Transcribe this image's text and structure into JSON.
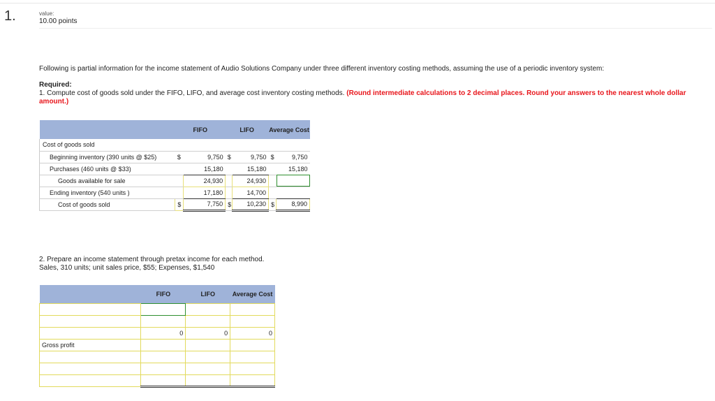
{
  "question": {
    "number": "1.",
    "value_label": "value:",
    "value_points": "10.00 points"
  },
  "intro": "Following is partial information for the income statement of Audio Solutions Company under three different inventory costing methods, assuming the use of a periodic inventory system:",
  "required": {
    "heading": "Required:",
    "part1_prefix": "1. Compute cost of goods sold under the FIFO, LIFO, and average cost inventory costing methods.",
    "part1_instruction": "(Round intermediate calculations to 2 decimal places. Round your answers to the nearest whole dollar amount.)",
    "part2_line1": "2. Prepare an income statement through pretax income for each method.",
    "part2_line2": "Sales, 310 units; unit sales price, $55; Expenses, $1,540"
  },
  "table1": {
    "headers": {
      "fifo": "FIFO",
      "lifo": "LIFO",
      "avg": "Average Cost"
    },
    "section_label": "Cost of goods sold",
    "rows": [
      {
        "label": "Beginning inventory (390 units @ $25)",
        "d1": "$",
        "fifo": "9,750",
        "d2": "$",
        "lifo": "9,750",
        "d3": "$",
        "avg": "9,750"
      },
      {
        "label": "Purchases (460 units @ $33)",
        "d1": "",
        "fifo": "15,180",
        "d2": "",
        "lifo": "15,180",
        "d3": "",
        "avg": "15,180"
      },
      {
        "label": "Goods available for sale",
        "d1": "",
        "fifo": "24,930",
        "d2": "",
        "lifo": "24,930",
        "d3": "",
        "avg": ""
      },
      {
        "label": "Ending inventory (540 units )",
        "d1": "",
        "fifo": "17,180",
        "d2": "",
        "lifo": "14,700",
        "d3": "",
        "avg": ""
      },
      {
        "label": "Cost of goods sold",
        "d1": "$",
        "fifo": "7,750",
        "d2": "$",
        "lifo": "10,230",
        "d3": "$",
        "avg": "8,990"
      }
    ]
  },
  "table2": {
    "headers": {
      "fifo": "FIFO",
      "lifo": "LIFO",
      "avg": "Average Cost"
    },
    "rows": [
      {
        "label": "",
        "fifo": "",
        "lifo": "",
        "avg": ""
      },
      {
        "label": "",
        "fifo": "",
        "lifo": "",
        "avg": ""
      },
      {
        "label": "",
        "fifo": "0",
        "lifo": "0",
        "avg": "0"
      },
      {
        "label": "Gross profit",
        "fifo": "",
        "lifo": "",
        "avg": ""
      },
      {
        "label": "",
        "fifo": "",
        "lifo": "",
        "avg": ""
      },
      {
        "label": "",
        "fifo": "",
        "lifo": "",
        "avg": ""
      },
      {
        "label": "",
        "fifo": "",
        "lifo": "",
        "avg": ""
      }
    ]
  }
}
